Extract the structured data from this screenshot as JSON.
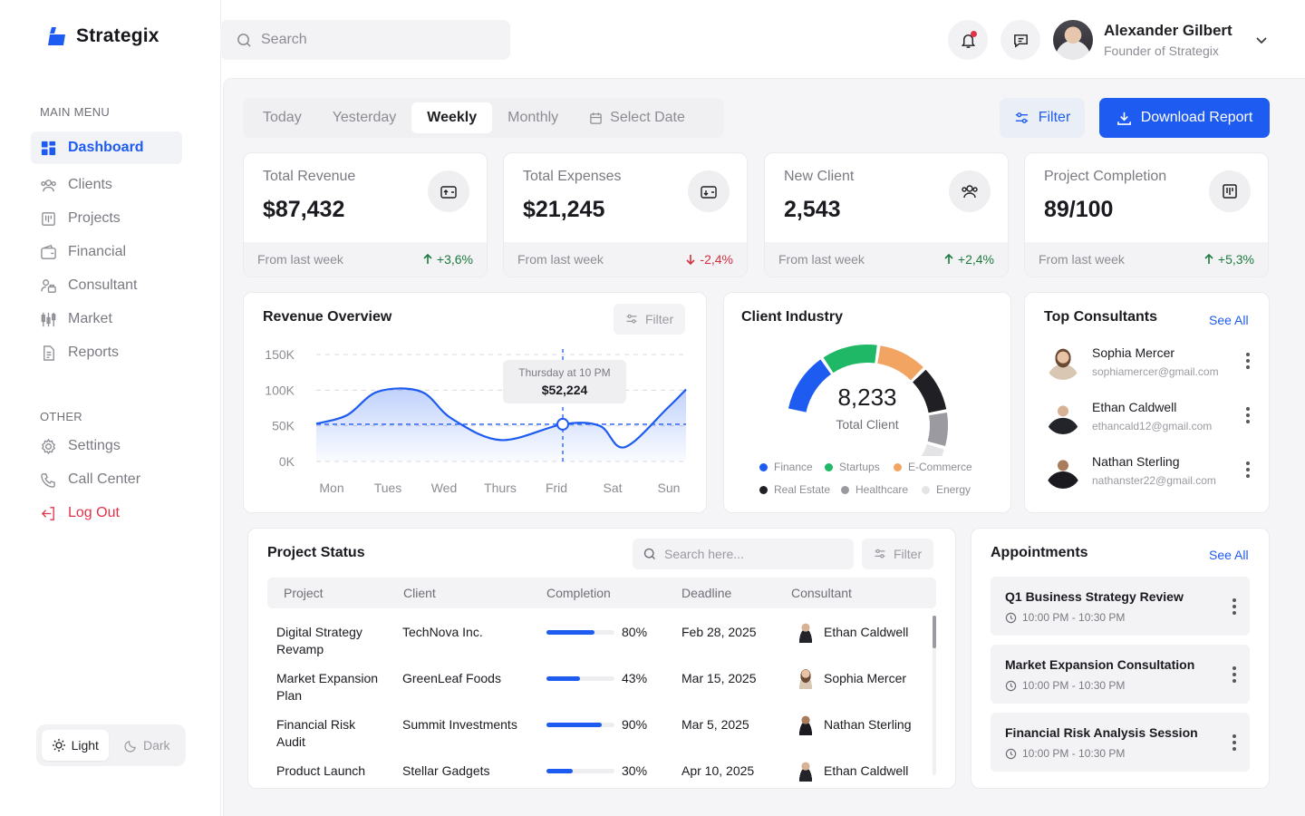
{
  "brand": {
    "name": "Strategix"
  },
  "search": {
    "placeholder": "Search"
  },
  "user": {
    "name": "Alexander Gilbert",
    "role": "Founder of Strategix"
  },
  "sidebar": {
    "main_heading": "MAIN MENU",
    "items": [
      {
        "label": "Dashboard",
        "icon": "grid-icon"
      },
      {
        "label": "Clients",
        "icon": "users-icon"
      },
      {
        "label": "Projects",
        "icon": "kanban-icon"
      },
      {
        "label": "Financial",
        "icon": "wallet-icon"
      },
      {
        "label": "Consultant",
        "icon": "consultant-icon"
      },
      {
        "label": "Market",
        "icon": "candlestick-icon"
      },
      {
        "label": "Reports",
        "icon": "report-icon"
      }
    ],
    "other_heading": "OTHER",
    "other_items": [
      {
        "label": "Settings",
        "icon": "gear-icon"
      },
      {
        "label": "Call Center",
        "icon": "phone-icon"
      },
      {
        "label": "Log Out",
        "icon": "logout-icon"
      }
    ],
    "theme": {
      "light": "Light",
      "dark": "Dark"
    }
  },
  "toolbar": {
    "ranges": [
      "Today",
      "Yesterday",
      "Weekly",
      "Monthly"
    ],
    "select_date": "Select Date",
    "filter": "Filter",
    "download": "Download Report"
  },
  "kpis": [
    {
      "title": "Total Revenue",
      "value": "$87,432",
      "foot": "From last week",
      "delta": "+3,6%",
      "trend": "up"
    },
    {
      "title": "Total Expenses",
      "value": "$21,245",
      "foot": "From last week",
      "delta": "-2,4%",
      "trend": "down"
    },
    {
      "title": "New Client",
      "value": "2,543",
      "foot": "From last week",
      "delta": "+2,4%",
      "trend": "up"
    },
    {
      "title": "Project Completion",
      "value": "89/100",
      "foot": "From last week",
      "delta": "+5,3%",
      "trend": "up"
    }
  ],
  "revenue": {
    "title": "Revenue Overview",
    "filter": "Filter",
    "tooltip_label": "Thursday at 10 PM",
    "tooltip_value": "$52,224"
  },
  "chart_data": {
    "type": "area",
    "categories": [
      "Mon",
      "Tues",
      "Wed",
      "Thurs",
      "Frid",
      "Sat",
      "Sun"
    ],
    "y_ticks": [
      "150K",
      "100K",
      "50K",
      "0K"
    ],
    "ylim": [
      0,
      150000
    ],
    "x": [
      0,
      0.5,
      1,
      1.7,
      2.2,
      3,
      4,
      4.6,
      5,
      5.7,
      6
    ],
    "values": [
      53000,
      65000,
      98000,
      98000,
      60000,
      30000,
      52224,
      50000,
      20000,
      75000,
      101000
    ],
    "highlight": {
      "x": 4,
      "y": 52224
    },
    "reference_line": 52224,
    "grid": true,
    "color": "#1e5bf0"
  },
  "industry": {
    "title": "Client Industry",
    "total": "8,233",
    "total_label": "Total Client",
    "segments": [
      {
        "name": "Finance",
        "color": "#1e5bf0",
        "value": 17
      },
      {
        "name": "Startups",
        "color": "#1fb866",
        "value": 16
      },
      {
        "name": "E-Commerce",
        "color": "#f2a463",
        "value": 14
      },
      {
        "name": "Real Estate",
        "color": "#1f1f24",
        "value": 13
      },
      {
        "name": "Healthcare",
        "color": "#9a9aa0",
        "value": 10
      },
      {
        "name": "Energy",
        "color": "#e4e4e7",
        "value": 7
      }
    ]
  },
  "consultants": {
    "title": "Top Consultants",
    "see_all": "See All",
    "items": [
      {
        "name": "Sophia Mercer",
        "email": "sophiamercer@gmail.com"
      },
      {
        "name": "Ethan Caldwell",
        "email": "ethancald12@gmail.com"
      },
      {
        "name": "Nathan Sterling",
        "email": "nathanster22@gmail.com"
      }
    ]
  },
  "projects": {
    "title": "Project Status",
    "search_placeholder": "Search here...",
    "filter": "Filter",
    "columns": [
      "Project",
      "Client",
      "Completion",
      "Deadline",
      "Consultant"
    ],
    "rows": [
      {
        "project": "Digital Strategy Revamp",
        "client": "TechNova Inc.",
        "completion": 0.8,
        "completion_label": "80%",
        "deadline": "Feb 28, 2025",
        "consultant": "Ethan Caldwell"
      },
      {
        "project": "Market Expansion Plan",
        "client": "GreenLeaf Foods",
        "completion": 0.43,
        "completion_label": "43%",
        "deadline": "Mar 15, 2025",
        "consultant": "Sophia Mercer"
      },
      {
        "project": "Financial Risk Audit",
        "client": "Summit Investments",
        "completion": 0.9,
        "completion_label": "90%",
        "deadline": "Mar 5, 2025",
        "consultant": "Nathan Sterling"
      },
      {
        "project": "Product Launch",
        "client": "Stellar Gadgets",
        "completion": 0.3,
        "completion_label": "30%",
        "deadline": "Apr 10, 2025",
        "consultant": "Ethan Caldwell"
      }
    ]
  },
  "appointments": {
    "title": "Appointments",
    "see_all": "See All",
    "items": [
      {
        "title": "Q1 Business Strategy Review",
        "time": "10:00 PM - 10:30 PM"
      },
      {
        "title": "Market Expansion Consultation",
        "time": "10:00 PM - 10:30 PM"
      },
      {
        "title": "Financial Risk Analysis Session",
        "time": "10:00 PM - 10:30 PM"
      }
    ]
  }
}
